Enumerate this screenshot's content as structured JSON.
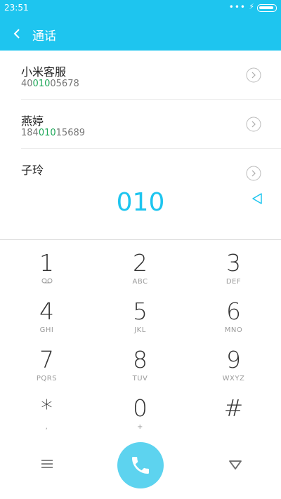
{
  "status": {
    "time": "23:51",
    "dots": "•••"
  },
  "appbar": {
    "title": "通话"
  },
  "contacts": [
    {
      "name": "小米客服",
      "num_pre": "40",
      "num_hl": "010",
      "num_post": "05678"
    },
    {
      "name": "燕婷",
      "num_pre": "184",
      "num_hl": "010",
      "num_post": "15689"
    },
    {
      "name": "子玲",
      "num_pre": "",
      "num_hl": "",
      "num_post": ""
    }
  ],
  "dialer": {
    "input": "010"
  },
  "keys": [
    {
      "digit": "1",
      "letters": "",
      "icon": "voicemail-icon"
    },
    {
      "digit": "2",
      "letters": "ABC"
    },
    {
      "digit": "3",
      "letters": "DEF"
    },
    {
      "digit": "4",
      "letters": "GHI"
    },
    {
      "digit": "5",
      "letters": "JKL"
    },
    {
      "digit": "6",
      "letters": "MNO"
    },
    {
      "digit": "7",
      "letters": "PQRS"
    },
    {
      "digit": "8",
      "letters": "TUV"
    },
    {
      "digit": "9",
      "letters": "WXYZ"
    },
    {
      "digit": "*",
      "letters": ","
    },
    {
      "digit": "0",
      "letters": "+"
    },
    {
      "digit": "#",
      "letters": ""
    }
  ],
  "colors": {
    "accent": "#1ec5ef",
    "call": "#5dd3ef",
    "match": "#1fa85a"
  }
}
